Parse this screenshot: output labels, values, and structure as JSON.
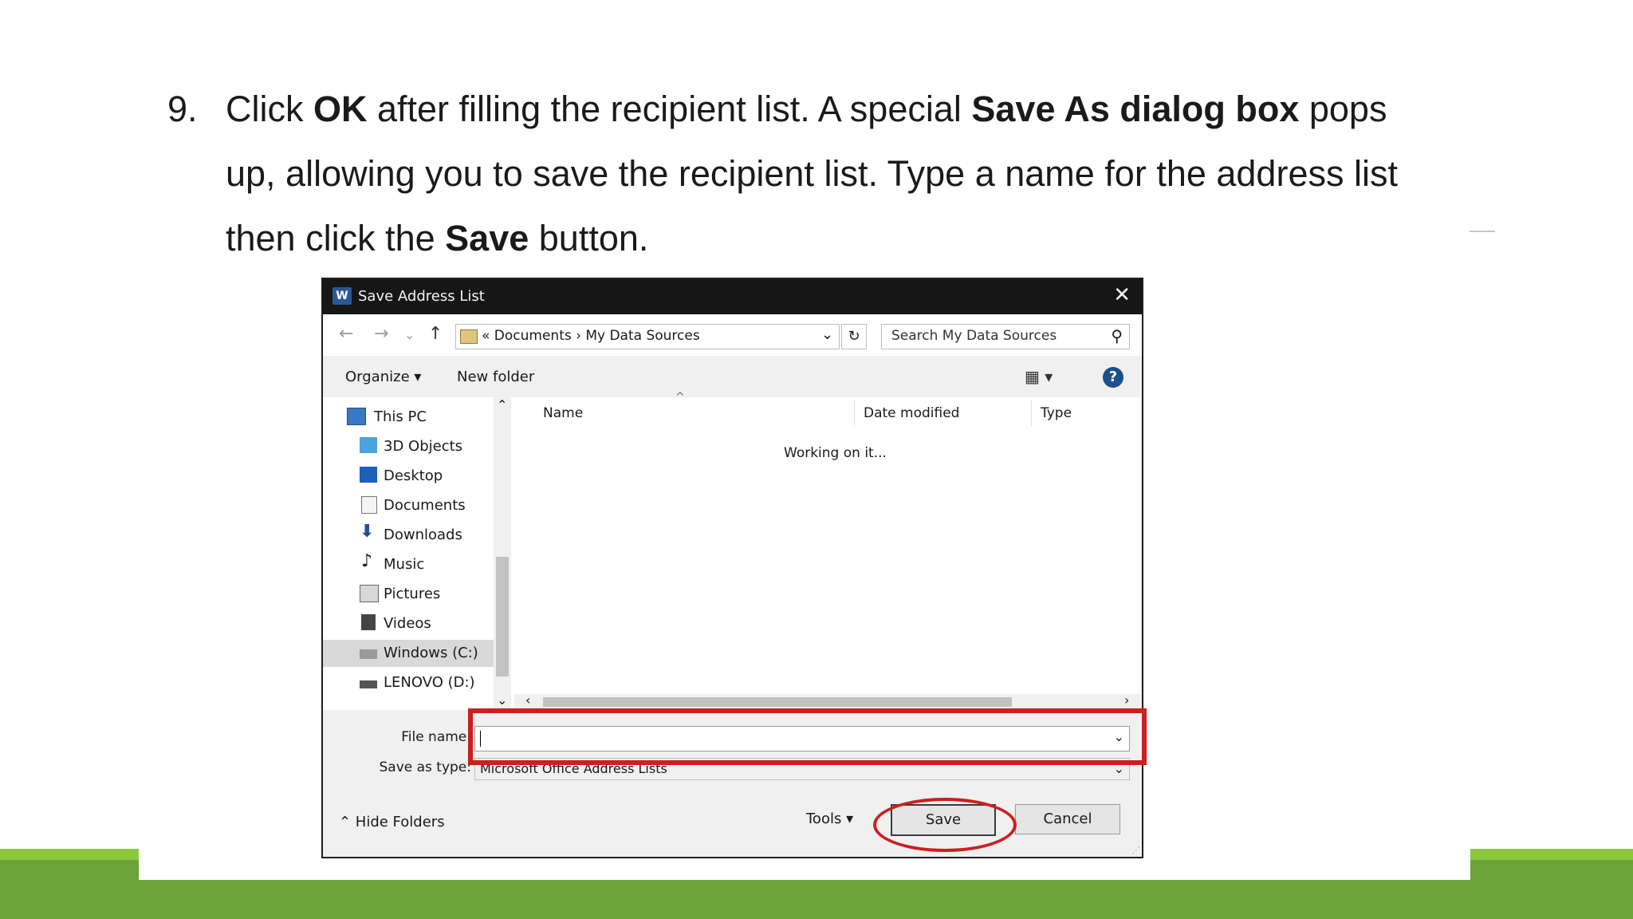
{
  "slide": {
    "step_number": "9.",
    "line1_pre": "Click ",
    "line1_b1": "OK",
    "line1_mid": " after filling the recipient list. A special ",
    "line1_b2": "Save As dialog box",
    "line1_post": " pops",
    "line2": "up, allowing you to save the recipient list. Type a name for the address list",
    "line3_pre": "then click the ",
    "line3_b": "Save",
    "line3_post": " button."
  },
  "dialog": {
    "title": "Save Address List",
    "close_glyph": "✕",
    "nav": {
      "back": "←",
      "forward": "→",
      "recent": "⌄",
      "up": "↑"
    },
    "address_path": "«  Documents  ›  My Data Sources",
    "address_dropdown": "⌄",
    "refresh_glyph": "↻",
    "search_placeholder": "Search My Data Sources",
    "search_glyph": "⚲",
    "toolbar": {
      "organize": "Organize ▾",
      "new_folder": "New folder",
      "views": "▦ ▾",
      "help": "?"
    },
    "nav_items": [
      {
        "label": "This PC",
        "icon": "pc-icon"
      },
      {
        "label": "3D Objects",
        "icon": "cube-icon"
      },
      {
        "label": "Desktop",
        "icon": "desktop-icon"
      },
      {
        "label": "Documents",
        "icon": "document-icon"
      },
      {
        "label": "Downloads",
        "icon": "download-icon"
      },
      {
        "label": "Music",
        "icon": "music-icon"
      },
      {
        "label": "Pictures",
        "icon": "pictures-icon"
      },
      {
        "label": "Videos",
        "icon": "videos-icon"
      },
      {
        "label": "Windows (C:)",
        "icon": "drive-icon"
      },
      {
        "label": "LENOVO (D:)",
        "icon": "drive-icon"
      }
    ],
    "columns": [
      "Name",
      "Date modified",
      "Type"
    ],
    "status_text": "Working on it...",
    "file_name_label": "File name:",
    "file_name_value": "",
    "save_type_label": "Save as type:",
    "save_type_value": "Microsoft Office Address Lists",
    "hide_folders": "⌃  Hide Folders",
    "tools": "Tools   ▾",
    "save_button": "Save",
    "cancel_button": "Cancel"
  },
  "colors": {
    "highlight_red": "#cc1f1f",
    "accent_green": "#6aa33a",
    "light_green": "#8dc63f"
  }
}
